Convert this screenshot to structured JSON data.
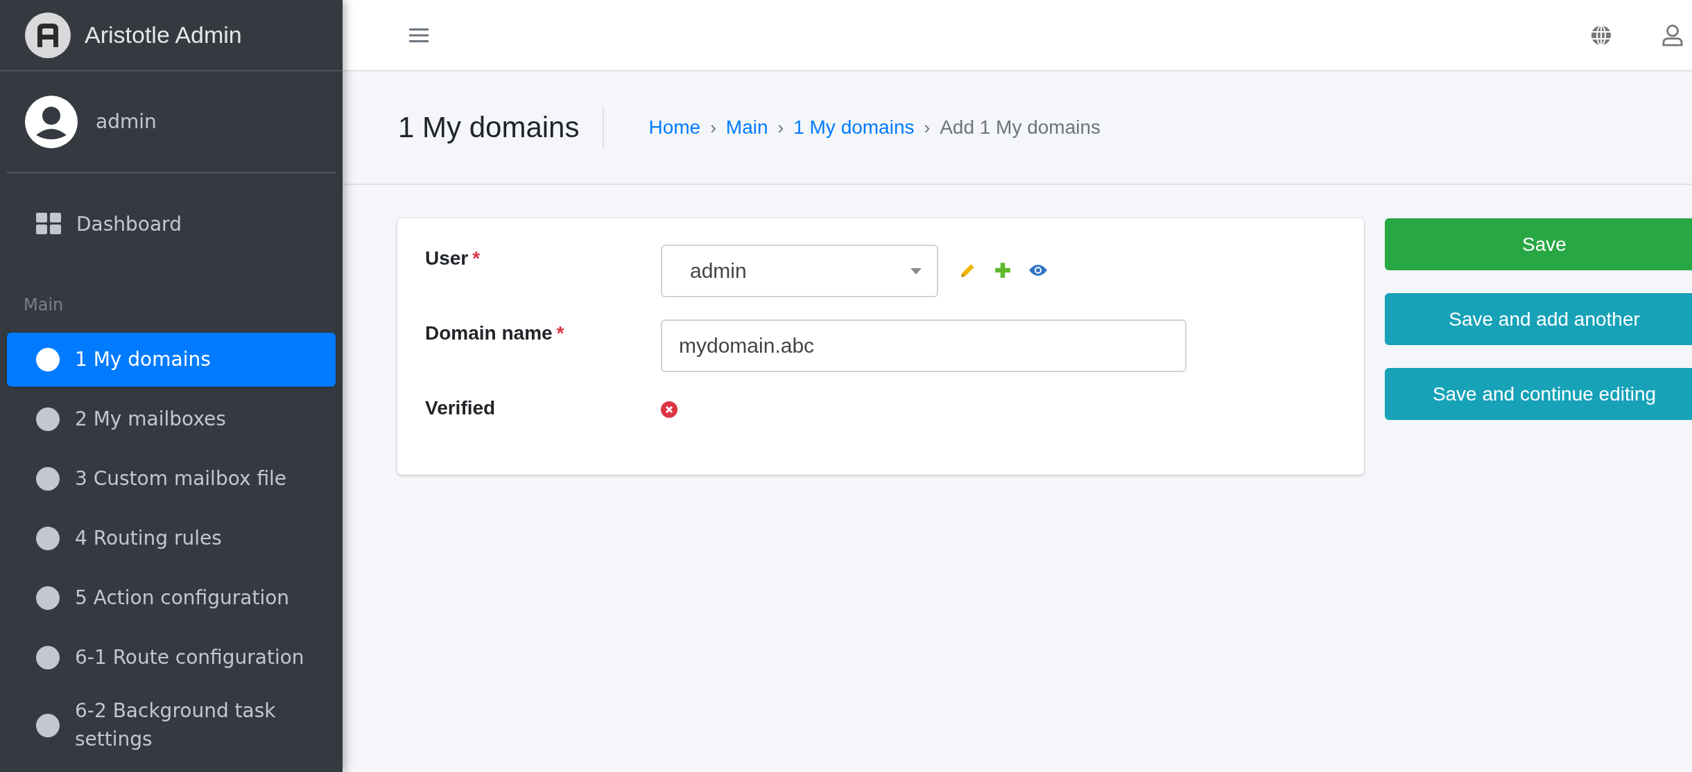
{
  "brand": {
    "title": "Aristotle Admin"
  },
  "user_panel": {
    "name": "admin"
  },
  "sidebar": {
    "dashboard": "Dashboard",
    "section_label": "Main",
    "items": [
      {
        "label": "1 My domains",
        "selected": true
      },
      {
        "label": "2 My mailboxes",
        "selected": false
      },
      {
        "label": "3 Custom mailbox file",
        "selected": false
      },
      {
        "label": "4 Routing rules",
        "selected": false
      },
      {
        "label": "5 Action configuration",
        "selected": false
      },
      {
        "label": "6-1 Route configuration",
        "selected": false
      },
      {
        "label": "6-2 Background task settings",
        "selected": false
      }
    ]
  },
  "page": {
    "title": "1 My domains",
    "breadcrumb": [
      {
        "label": "Home",
        "link": true
      },
      {
        "separator": "›",
        "label": "Main",
        "link": true
      },
      {
        "separator": "›",
        "label": "1 My domains",
        "link": true
      },
      {
        "separator": "›",
        "label": "Add 1 My domains",
        "link": false
      }
    ]
  },
  "form": {
    "fields": [
      {
        "kind": "select",
        "label": "User",
        "required_mark": "*",
        "value": "admin"
      },
      {
        "kind": "text",
        "label": "Domain name",
        "required_mark": "*",
        "value": "mydomain.abc"
      },
      {
        "kind": "boolean",
        "label": "Verified",
        "checked": false
      }
    ]
  },
  "actions": [
    {
      "label": "Save",
      "kind": "primary"
    },
    {
      "label": "Save and add another",
      "kind": "secondary"
    },
    {
      "label": "Save and continue editing",
      "kind": "secondary"
    }
  ]
}
